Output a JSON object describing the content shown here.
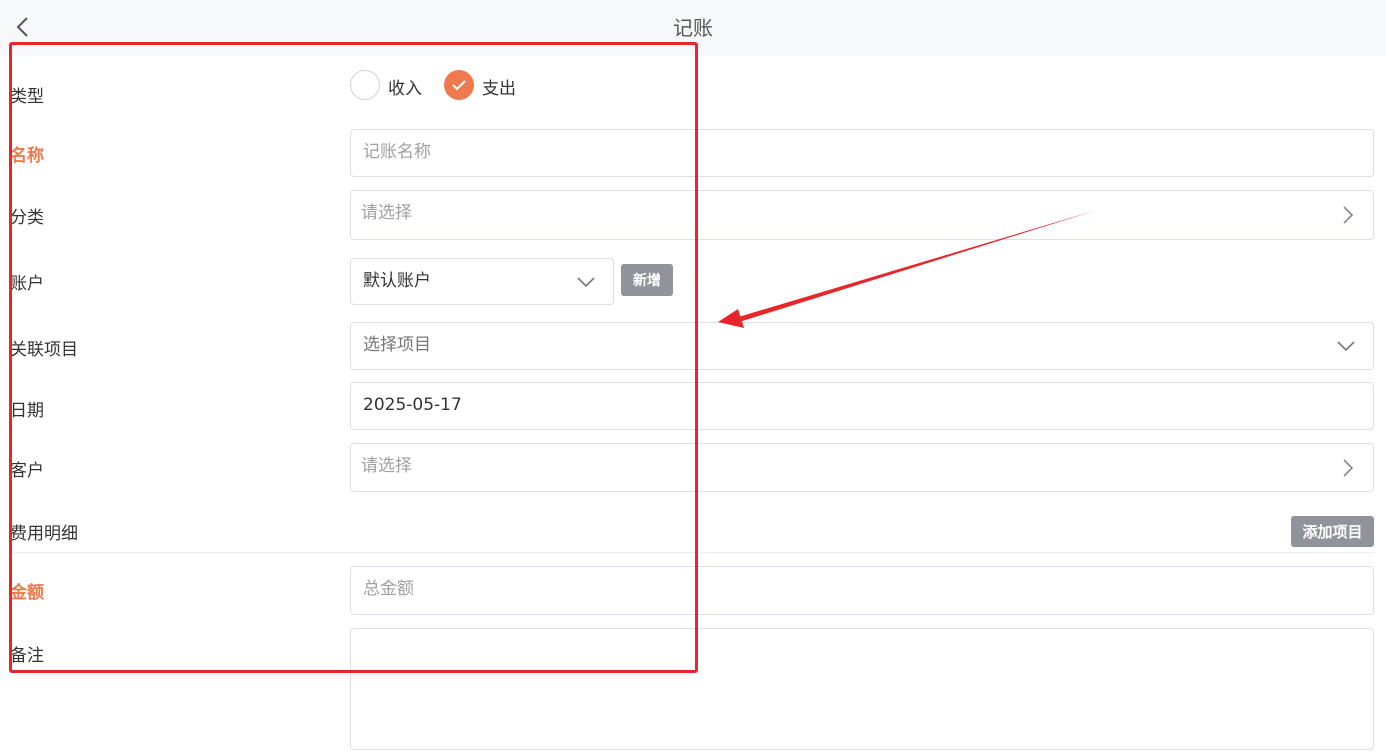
{
  "header": {
    "title": "记账",
    "back_icon": "chevron-left-icon"
  },
  "type": {
    "label": "类型",
    "options": [
      {
        "label": "收入",
        "selected": false
      },
      {
        "label": "支出",
        "selected": true
      }
    ]
  },
  "name": {
    "label": "名称",
    "placeholder": "记账名称"
  },
  "category": {
    "label": "分类",
    "placeholder": "请选择"
  },
  "account": {
    "label": "账户",
    "value": "默认账户",
    "add_button": "新增"
  },
  "project": {
    "label": "关联项目",
    "placeholder": "选择项目"
  },
  "date": {
    "label": "日期",
    "value": "2025-05-17"
  },
  "customer": {
    "label": "客户",
    "placeholder": "请选择"
  },
  "expense": {
    "label": "费用明细",
    "add_button": "添加项目"
  },
  "amount": {
    "label": "金额",
    "placeholder": "总金额"
  },
  "remark": {
    "label": "备注",
    "value": ""
  },
  "colors": {
    "accent": "#f07a4f",
    "annotation": "#e8262a",
    "button_gray": "#909399"
  }
}
